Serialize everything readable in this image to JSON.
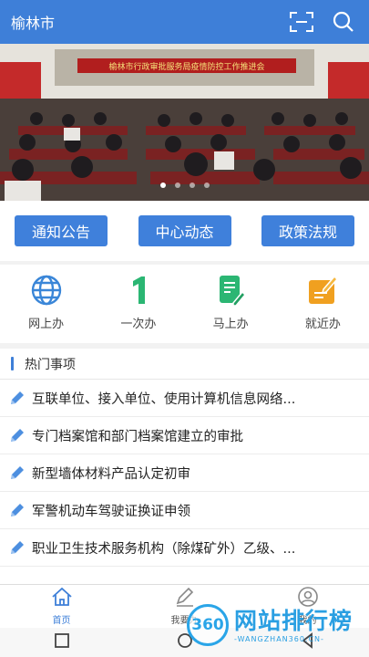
{
  "header": {
    "title": "榆林市"
  },
  "banner": {
    "caption": "榆林市行政审批服务局疫情防控工作推进会",
    "slides": 4,
    "active_slide": 0
  },
  "tabs": [
    {
      "label": "通知公告"
    },
    {
      "label": "中心动态"
    },
    {
      "label": "政策法规"
    }
  ],
  "quick": [
    {
      "label": "网上办",
      "icon": "globe-icon",
      "color": "#3a86d8"
    },
    {
      "label": "一次办",
      "icon": "number-one-icon",
      "color": "#2bb673"
    },
    {
      "label": "马上办",
      "icon": "document-edit-icon",
      "color": "#2bb673"
    },
    {
      "label": "就近办",
      "icon": "form-pen-icon",
      "color": "#f0a020"
    }
  ],
  "hot": {
    "title": "热门事项",
    "items": [
      "互联单位、接入单位、使用计算机信息网络...",
      "专门档案馆和部门档案馆建立的审批",
      "新型墙体材料产品认定初审",
      "军警机动车驾驶证换证申领",
      "职业卫生技术服务机构（除煤矿外）乙级、..."
    ]
  },
  "nav": [
    {
      "label": "首页",
      "icon": "home-icon",
      "active": true
    },
    {
      "label": "我要办",
      "icon": "pen-icon",
      "active": false
    },
    {
      "label": "我的",
      "icon": "user-icon",
      "active": false
    }
  ],
  "watermark": {
    "logo": "360",
    "main": "网站排行榜",
    "sub": "-WANGZHAN360.CN-"
  },
  "colors": {
    "primary": "#3e7fd8",
    "button": "#3f80db"
  }
}
